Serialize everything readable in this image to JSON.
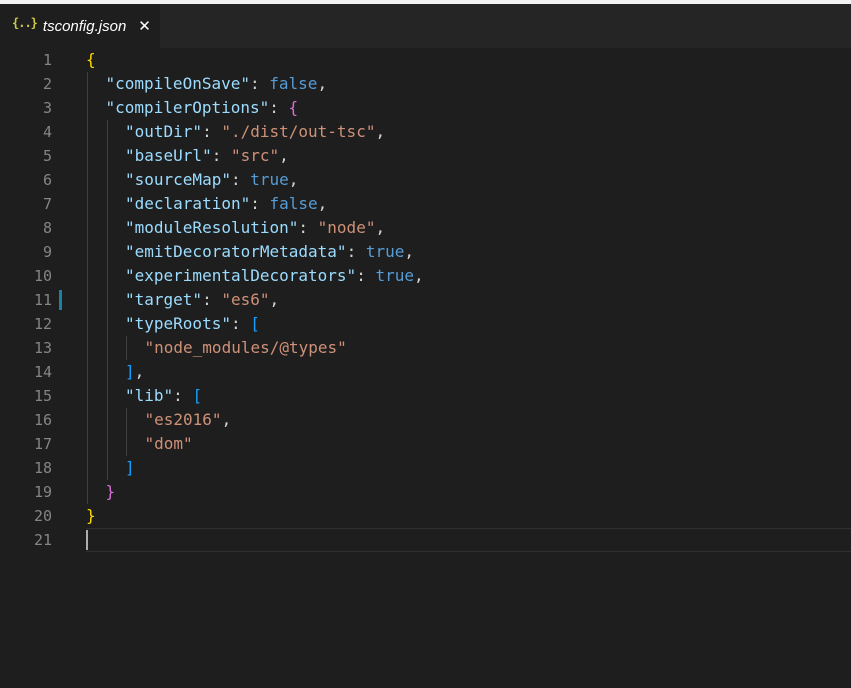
{
  "tab": {
    "title": "tsconfig.json",
    "icon_glyph": "{..}",
    "icon": "json-braces-icon",
    "close_glyph": "✕",
    "close_icon": "close-icon"
  },
  "colors": {
    "editor_background": "#1e1e1e",
    "key": "#9cdcfe",
    "string": "#ce9178",
    "boolean": "#569cd6",
    "bracket_level1": "#ffd700",
    "bracket_level2": "#da70d6",
    "bracket_level3": "#179fff",
    "line_number": "#858585",
    "modified_marker": "#1b81a8"
  },
  "editor": {
    "cursor_line": 21,
    "modified_line": 11,
    "lines": [
      {
        "n": "1",
        "tokens": [
          [
            "b1",
            "{"
          ]
        ]
      },
      {
        "n": "2",
        "tokens": [
          [
            "key",
            "\"compileOnSave\""
          ],
          [
            "punc",
            ": "
          ],
          [
            "bool",
            "false"
          ],
          [
            "punc",
            ","
          ]
        ]
      },
      {
        "n": "3",
        "tokens": [
          [
            "key",
            "\"compilerOptions\""
          ],
          [
            "punc",
            ": "
          ],
          [
            "b2",
            "{"
          ]
        ]
      },
      {
        "n": "4",
        "tokens": [
          [
            "key",
            "\"outDir\""
          ],
          [
            "punc",
            ": "
          ],
          [
            "str",
            "\"./dist/out-tsc\""
          ],
          [
            "punc",
            ","
          ]
        ]
      },
      {
        "n": "5",
        "tokens": [
          [
            "key",
            "\"baseUrl\""
          ],
          [
            "punc",
            ": "
          ],
          [
            "str",
            "\"src\""
          ],
          [
            "punc",
            ","
          ]
        ]
      },
      {
        "n": "6",
        "tokens": [
          [
            "key",
            "\"sourceMap\""
          ],
          [
            "punc",
            ": "
          ],
          [
            "bool",
            "true"
          ],
          [
            "punc",
            ","
          ]
        ]
      },
      {
        "n": "7",
        "tokens": [
          [
            "key",
            "\"declaration\""
          ],
          [
            "punc",
            ": "
          ],
          [
            "bool",
            "false"
          ],
          [
            "punc",
            ","
          ]
        ]
      },
      {
        "n": "8",
        "tokens": [
          [
            "key",
            "\"moduleResolution\""
          ],
          [
            "punc",
            ": "
          ],
          [
            "str",
            "\"node\""
          ],
          [
            "punc",
            ","
          ]
        ]
      },
      {
        "n": "9",
        "tokens": [
          [
            "key",
            "\"emitDecoratorMetadata\""
          ],
          [
            "punc",
            ": "
          ],
          [
            "bool",
            "true"
          ],
          [
            "punc",
            ","
          ]
        ]
      },
      {
        "n": "10",
        "tokens": [
          [
            "key",
            "\"experimentalDecorators\""
          ],
          [
            "punc",
            ": "
          ],
          [
            "bool",
            "true"
          ],
          [
            "punc",
            ","
          ]
        ]
      },
      {
        "n": "11",
        "tokens": [
          [
            "key",
            "\"target\""
          ],
          [
            "punc",
            ": "
          ],
          [
            "str",
            "\"es6\""
          ],
          [
            "punc",
            ","
          ]
        ]
      },
      {
        "n": "12",
        "tokens": [
          [
            "key",
            "\"typeRoots\""
          ],
          [
            "punc",
            ": "
          ],
          [
            "b3",
            "["
          ]
        ]
      },
      {
        "n": "13",
        "tokens": [
          [
            "str",
            "\"node_modules/@types\""
          ]
        ]
      },
      {
        "n": "14",
        "tokens": [
          [
            "b3",
            "]"
          ],
          [
            "punc",
            ","
          ]
        ]
      },
      {
        "n": "15",
        "tokens": [
          [
            "key",
            "\"lib\""
          ],
          [
            "punc",
            ": "
          ],
          [
            "b3",
            "["
          ]
        ]
      },
      {
        "n": "16",
        "tokens": [
          [
            "str",
            "\"es2016\""
          ],
          [
            "punc",
            ","
          ]
        ]
      },
      {
        "n": "17",
        "tokens": [
          [
            "str",
            "\"dom\""
          ]
        ]
      },
      {
        "n": "18",
        "tokens": [
          [
            "b3",
            "]"
          ]
        ]
      },
      {
        "n": "19",
        "tokens": [
          [
            "b2",
            "}"
          ]
        ]
      },
      {
        "n": "20",
        "tokens": [
          [
            "b1",
            "}"
          ]
        ]
      },
      {
        "n": "21",
        "tokens": []
      }
    ]
  }
}
